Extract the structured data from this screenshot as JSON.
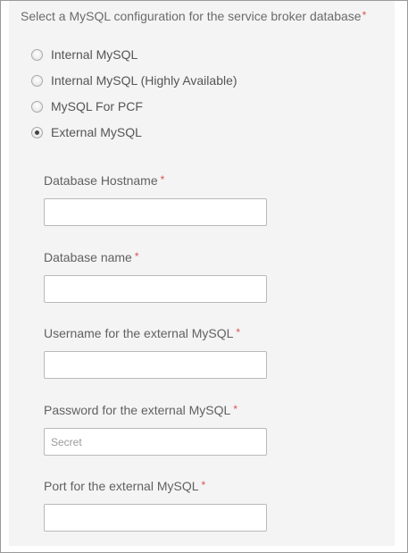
{
  "heading": {
    "text": "Select a MySQL configuration for the service broker database",
    "required_mark": "*"
  },
  "options": [
    {
      "label": "Internal MySQL",
      "selected": false
    },
    {
      "label": "Internal MySQL (Highly Available)",
      "selected": false
    },
    {
      "label": "MySQL For PCF",
      "selected": false
    },
    {
      "label": "External MySQL",
      "selected": true
    }
  ],
  "fields": {
    "hostname": {
      "label": "Database Hostname",
      "required_mark": "*",
      "value": "",
      "placeholder": ""
    },
    "dbname": {
      "label": "Database name",
      "required_mark": "*",
      "value": "",
      "placeholder": ""
    },
    "username": {
      "label": "Username for the external MySQL",
      "required_mark": "*",
      "value": "",
      "placeholder": ""
    },
    "password": {
      "label": "Password for the external MySQL",
      "required_mark": "*",
      "value": "",
      "placeholder": "Secret"
    },
    "port": {
      "label": "Port for the external MySQL",
      "required_mark": "*",
      "value": "",
      "placeholder": ""
    }
  },
  "colors": {
    "required": "#d9534f",
    "panel_background": "#f4f4f4",
    "input_border": "#b9b9b9"
  }
}
